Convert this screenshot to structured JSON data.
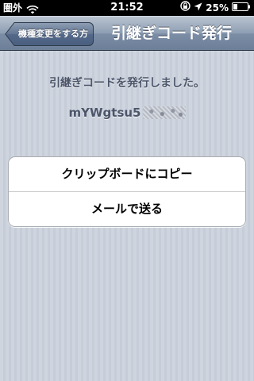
{
  "status_bar": {
    "carrier": "圏外",
    "time": "21:52",
    "battery": "25%",
    "icons": [
      "wifi-icon",
      "rotation-lock-icon",
      "location-arrow-icon",
      "battery-icon"
    ]
  },
  "nav_bar": {
    "back_label": "機種変更をする方",
    "title": "引継ぎコード発行"
  },
  "main": {
    "message": "引継ぎコードを発行しました。",
    "code_visible": "mYWgtsu5",
    "buttons": {
      "copy_label": "クリップボードにコピー",
      "mail_label": "メールで送る"
    }
  },
  "colors": {
    "nav_bar": "#8d9eb3",
    "background": "#cdd3dd",
    "text_muted": "#4c566a",
    "button_bg": "#ffffff"
  }
}
